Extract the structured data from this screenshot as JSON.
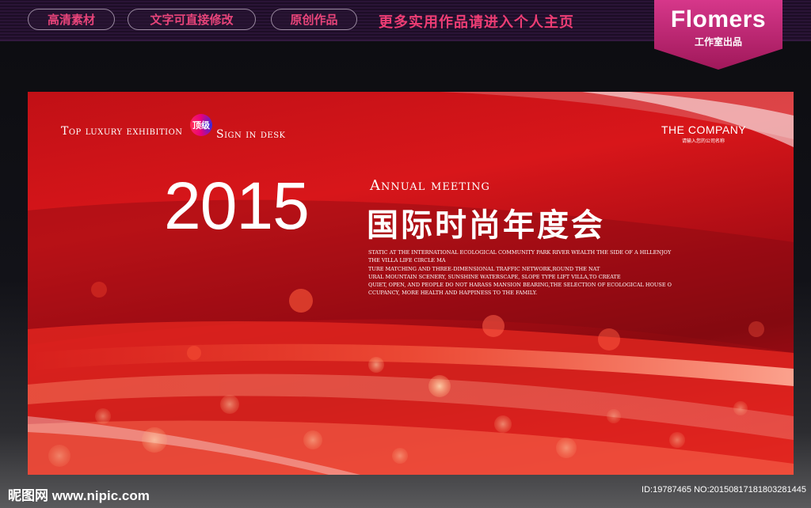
{
  "top_banner": {
    "buttons": [
      {
        "label": "高清素材"
      },
      {
        "label": "文字可直接修改"
      },
      {
        "label": "原创作品"
      }
    ],
    "promo_text": "更多实用作品请进入个人主页",
    "logo": {
      "brand": "Flomers",
      "sub": "工作室出品"
    }
  },
  "poster": {
    "top_left_a": "Top luxury exhibition",
    "badge": "顶级",
    "top_left_b": "Sign in desk",
    "company": "THE COMPANY",
    "company_sub": "请输入您的公司名称",
    "year": "2015",
    "annual": "Annual meeting",
    "title_cn": "国际时尚年度会",
    "description_lines": [
      "STATIC AT THE INTERNATIONAL ECOLOGICAL COMMUNITY PARK RIVER WEALTH THE SIDE OF A HILLENJOY",
      "THE VILLA LIFE CIRCLE MA",
      "TURE MATCHING AND THREE-DIMENSIONAL TRAFFIC NETWORK,ROUND THE NAT",
      "URAL MOUNTAIN SCENERY, SUNSHINE WATERSCAPE, SLOPE TYPE LIFT VILLA,TO CREATE",
      "QUIET, OPEN, AND PEOPLE DO NOT HARASS MANSION BEARING,THE SELECTION OF ECOLOGICAL HOUSE O",
      "CCUPANCY, MORE HEALTH AND HAPPINESS TO THE FAMILY."
    ]
  },
  "footer": {
    "site": "昵图网 www.nipic.com",
    "id_text": "ID:19787465 NO:20150817181803281445"
  },
  "colors": {
    "pink_accent": "#ee3d74",
    "poster_red": "#d8161a",
    "badge_magenta": "#d6378a"
  }
}
